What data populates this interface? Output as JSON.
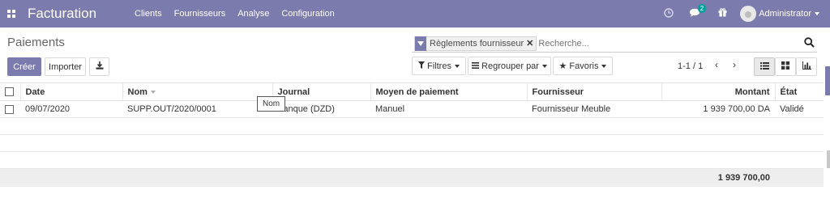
{
  "app": {
    "title": "Facturation",
    "apps_icon": "apps-grid-icon"
  },
  "menu": {
    "items": [
      "Clients",
      "Fournisseurs",
      "Analyse",
      "Configuration"
    ]
  },
  "systray": {
    "activity_icon": "clock-icon",
    "chat_icon": "chat-icon",
    "chat_badge": "2",
    "gift_icon": "gift-icon",
    "user_name": "Administrator"
  },
  "control": {
    "title": "Paiements",
    "create_label": "Créer",
    "import_label": "Importer",
    "download_icon": "download-icon",
    "filters_label": "Filtres",
    "groupby_label": "Regrouper par",
    "favorites_label": "Favoris",
    "pager": "1-1 / 1",
    "view_icons": [
      "list-view-icon",
      "kanban-view-icon",
      "graph-view-icon"
    ]
  },
  "search": {
    "facet_icon": "filter-icon",
    "facet_label": "Règlements fournisseur",
    "placeholder": "Recherche..."
  },
  "table": {
    "headers": [
      "Date",
      "Nom",
      "Journal",
      "Moyen de paiement",
      "Fournisseur",
      "Montant",
      "État"
    ],
    "rows": [
      {
        "date": "09/07/2020",
        "name": "SUPP.OUT/2020/0001",
        "journal": "Banque (DZD)",
        "method": "Manuel",
        "partner": "Fournisseur Meuble",
        "amount": "1 939 700,00 DA",
        "state": "Validé"
      }
    ],
    "total": "1 939 700,00"
  },
  "tooltip": {
    "text": "Nom"
  },
  "colors": {
    "brand": "#7c7bad",
    "badge": "#00a09d"
  }
}
